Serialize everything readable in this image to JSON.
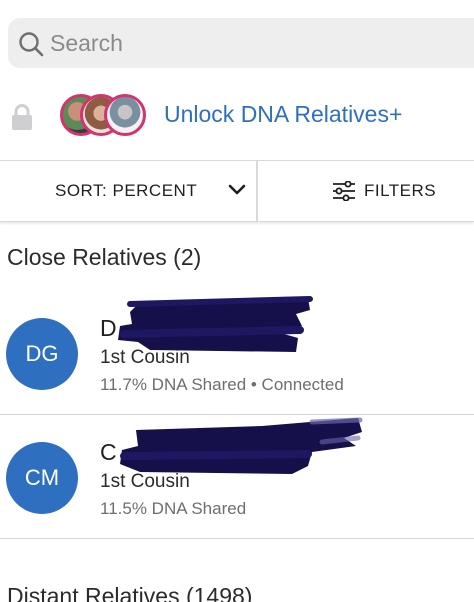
{
  "search": {
    "placeholder": "Search",
    "icon": "search-icon"
  },
  "unlock": {
    "lock_icon": "lock-icon",
    "label": "Unlock DNA Relatives+",
    "accent_color": "#2e6fc0",
    "avatar_border_color": "#d2346f"
  },
  "toolbar": {
    "sort_label": "SORT: PERCENT",
    "sort_icon": "chevron-down-icon",
    "filter_label": "FILTERS",
    "filter_icon": "sliders-icon"
  },
  "sections": {
    "close": {
      "header": "Close Relatives (2)",
      "relatives": [
        {
          "initials": "DG",
          "name": "D",
          "relation": "1st Cousin",
          "shared": "11.7% DNA Shared • Connected"
        },
        {
          "initials": "CM",
          "name": "C",
          "relation": "1st Cousin",
          "shared": "11.5% DNA Shared"
        }
      ]
    },
    "distant": {
      "header": "Distant Relatives (1498)"
    }
  },
  "colors": {
    "initials_bg": "#2e6fc0",
    "search_bg": "#eeeeef",
    "redaction": "#15104a"
  }
}
